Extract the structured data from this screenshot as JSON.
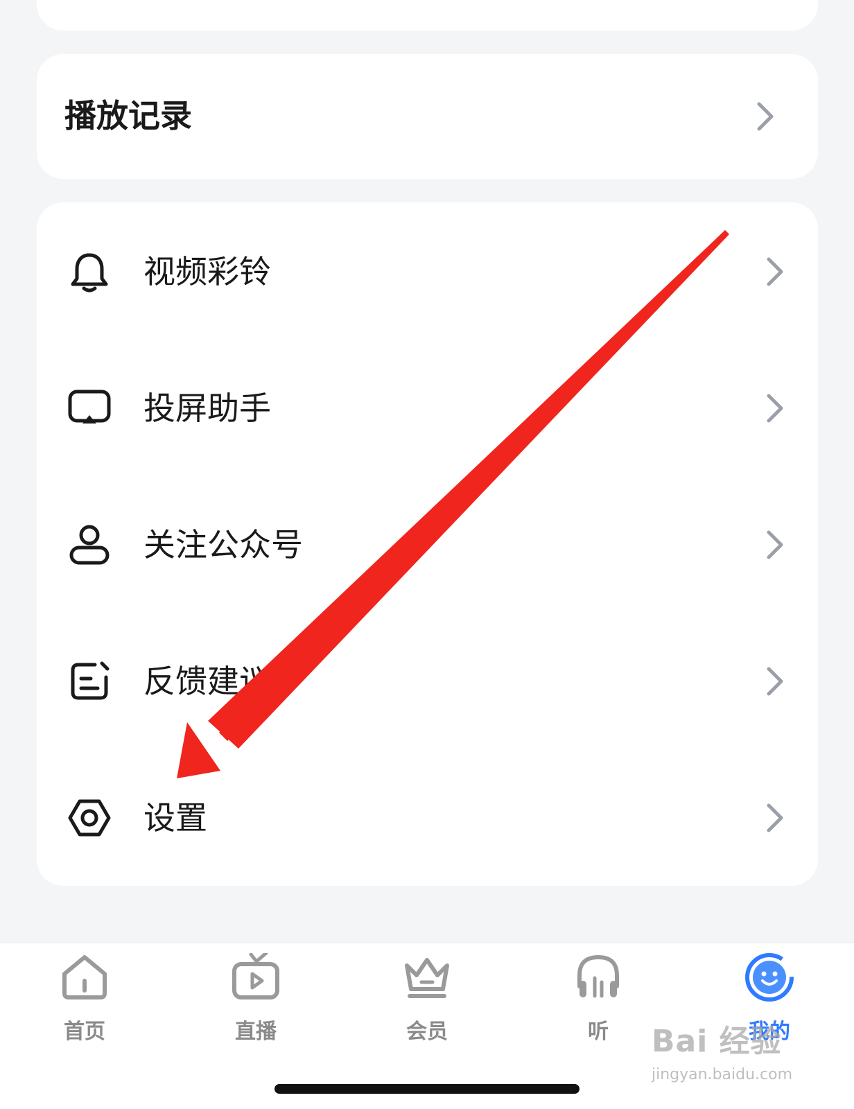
{
  "history": {
    "title": "播放记录"
  },
  "menu": [
    {
      "label": "视频彩铃",
      "icon": "bell-icon"
    },
    {
      "label": "投屏助手",
      "icon": "cast-screen-icon"
    },
    {
      "label": "关注公众号",
      "icon": "person-icon"
    },
    {
      "label": "反馈建议",
      "icon": "feedback-edit-icon"
    },
    {
      "label": "设置",
      "icon": "settings-hexagon-icon"
    }
  ],
  "tabs": [
    {
      "label": "首页",
      "icon": "home-icon",
      "active": false
    },
    {
      "label": "直播",
      "icon": "tv-live-icon",
      "active": false
    },
    {
      "label": "会员",
      "icon": "crown-icon",
      "active": false
    },
    {
      "label": "听",
      "icon": "headphones-icon",
      "active": false
    },
    {
      "label": "我的",
      "icon": "profile-face-icon",
      "active": true
    }
  ],
  "watermark": {
    "brand": "Bai 经验",
    "url": "jingyan.baidu.com"
  },
  "colors": {
    "accent": "#2f7bff",
    "annotation_arrow": "#f0251e",
    "background": "#f4f5f7"
  }
}
